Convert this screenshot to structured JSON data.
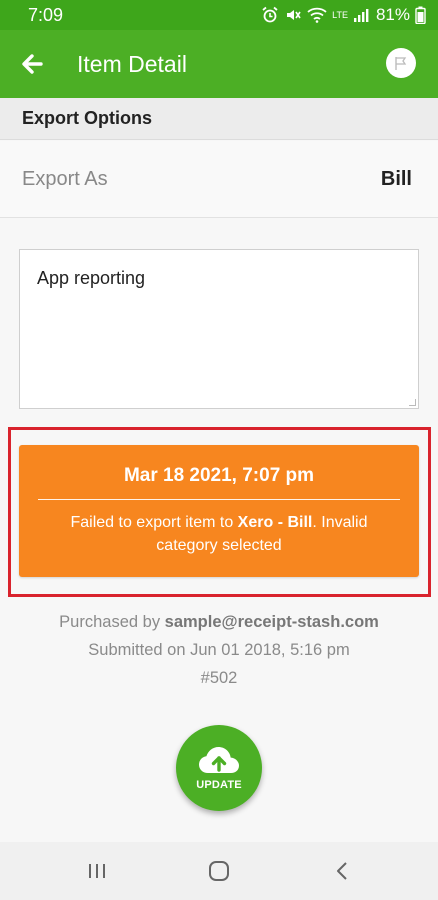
{
  "status_bar": {
    "time": "7:09",
    "network": "LTE",
    "battery": "81%"
  },
  "app_bar": {
    "title": "Item Detail"
  },
  "export_options": {
    "header": "Export Options",
    "export_as_label": "Export As",
    "export_as_value": "Bill"
  },
  "notes": {
    "value": "App reporting"
  },
  "export_error": {
    "date": "Mar 18 2021, 7:07 pm",
    "message_prefix": "Failed to export item to ",
    "message_target": "Xero - Bill",
    "message_suffix": ". Invalid category selected"
  },
  "meta": {
    "purchased_by_label": "Purchased by ",
    "purchased_by_email": "sample@receipt-stash.com",
    "submitted": "Submitted on Jun 01 2018, 5:16 pm",
    "item_number": "#502"
  },
  "update_button": {
    "label": "UPDATE"
  },
  "colors": {
    "app_bar": "#4caf25",
    "status_bar": "#3ea61b",
    "error_card": "#f7861f",
    "highlight": "#d9232d"
  },
  "icons": {
    "back": "arrow-left-icon",
    "flag": "flag-icon",
    "update": "cloud-upload-icon",
    "nav_recents": "recents-icon",
    "nav_home": "home-icon",
    "nav_back": "back-chevron-icon"
  }
}
